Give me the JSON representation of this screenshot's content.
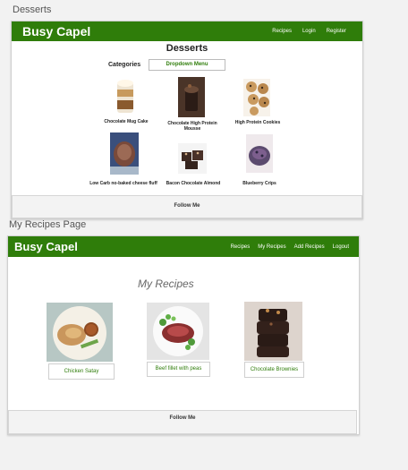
{
  "frames": {
    "desserts_label": "Desserts",
    "my_recipes_label": "My Recipes Page"
  },
  "desserts": {
    "brand": "Busy Capel",
    "nav": [
      "Recipes",
      "Login",
      "Register"
    ],
    "title": "Desserts",
    "categories_label": "Categories",
    "dropdown_label": "Dropdown Menu",
    "recipes": [
      "Chocolate Mug Cake",
      "Chocolate High Protein Mousse",
      "High Protein Cookies",
      "Low Carb no-baked cheese fluff",
      "Bacon Chocolate Almond",
      "Blueberry Crips"
    ],
    "footer": "Follow Me"
  },
  "my_recipes": {
    "brand": "Busy Capel",
    "nav": [
      "Recipes",
      "My Recipes",
      "Add Recipes",
      "Logout"
    ],
    "title": "My Recipes",
    "cards": [
      "Chicken Satay",
      "Beef fillet with peas",
      "Chocolate Brownies"
    ],
    "footer": "Follow Me"
  },
  "colors": {
    "brand_green": "#2f7d0a"
  }
}
